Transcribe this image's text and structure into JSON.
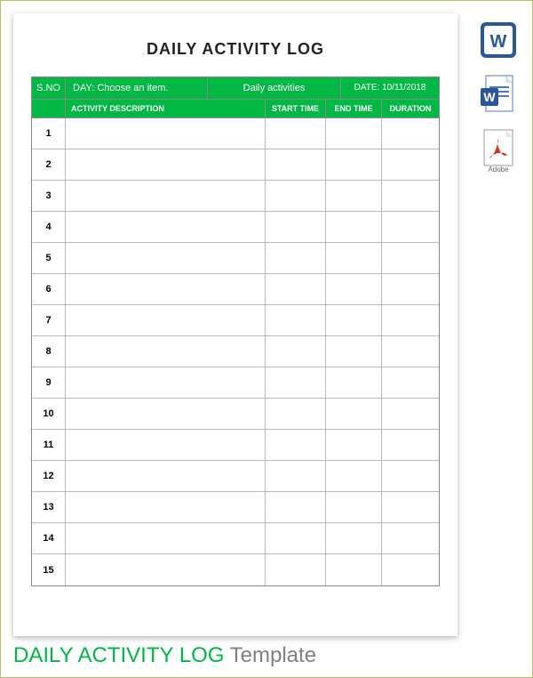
{
  "title": "DAILY ACTIVITY LOG",
  "header1": {
    "sno": "S.NO",
    "day_label": "DAY:",
    "day_value": "Choose an item.",
    "activities": "Daily activities",
    "date_label": "DATE:",
    "date_value": "10/11/2018"
  },
  "header2": {
    "desc": "ACTIVITY DESCRIPTION",
    "start": "START TIME",
    "end": "END TIME",
    "dur": "DURATION"
  },
  "rows": [
    {
      "num": "1"
    },
    {
      "num": "2"
    },
    {
      "num": "3"
    },
    {
      "num": "4"
    },
    {
      "num": "5"
    },
    {
      "num": "6"
    },
    {
      "num": "7"
    },
    {
      "num": "8"
    },
    {
      "num": "9"
    },
    {
      "num": "10"
    },
    {
      "num": "11"
    },
    {
      "num": "12"
    },
    {
      "num": "13"
    },
    {
      "num": "14"
    },
    {
      "num": "15"
    }
  ],
  "caption": {
    "main": "DAILY ACTIVITY LOG",
    "suffix": " Template"
  },
  "colors": {
    "green": "#00b843",
    "border": "#c0c060"
  },
  "downloads": {
    "word": "word-icon",
    "wordDoc": "word-doc-icon",
    "pdf": "pdf-icon"
  }
}
